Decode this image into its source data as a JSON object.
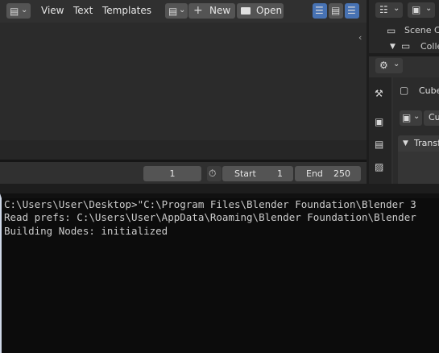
{
  "text_editor": {
    "menu": [
      "View",
      "Text",
      "Templates"
    ],
    "new_label": "New",
    "open_label": "Open"
  },
  "timeline": {
    "current_frame": "1",
    "start_label": "Start",
    "start_value": "1",
    "end_label": "End",
    "end_value": "250"
  },
  "outliner": {
    "scene_collection": "Scene Co",
    "collection": "Colle"
  },
  "properties": {
    "object_name": "Cube",
    "mesh_name": "Cu",
    "panel_transform": "Transf"
  },
  "console": {
    "lines": [
      "C:\\Users\\User\\Desktop>\"C:\\Program Files\\Blender Foundation\\Blender 3",
      "Read prefs: C:\\Users\\User\\AppData\\Roaming\\Blender Foundation\\Blender",
      "Building Nodes: initialized"
    ]
  }
}
